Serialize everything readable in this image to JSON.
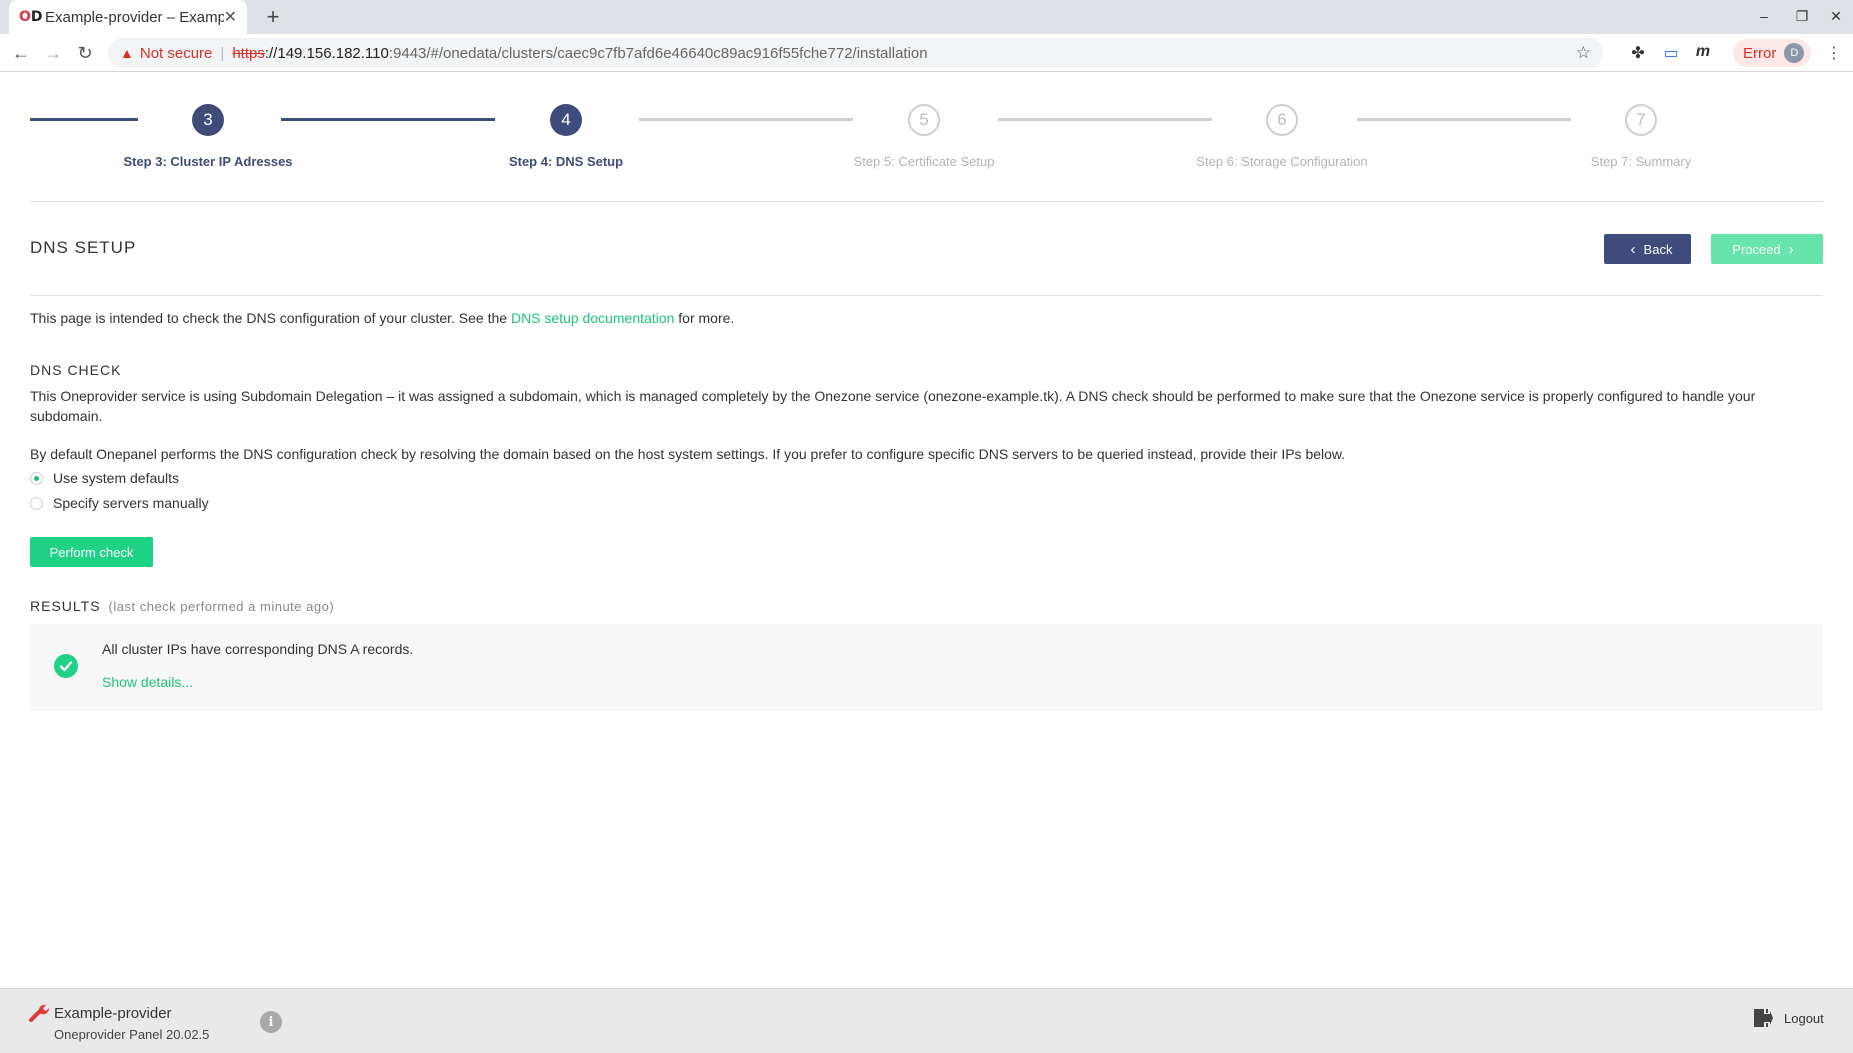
{
  "browser": {
    "tab_title": "Example-provider – Example",
    "favicon_text_a": "O",
    "favicon_text_b": "D",
    "new_tab": "+",
    "not_secure": "Not secure",
    "url_scheme": "https",
    "url_host": "://149.156.182.110",
    "url_rest": ":9443/#/onedata/clusters/caec9c7fb7afd6e46640c89ac916f55fche772/installation",
    "error_label": "Error",
    "profile_initial": "D"
  },
  "stepper": {
    "steps": [
      {
        "number": "3",
        "label": "Step 3: Cluster IP Adresses",
        "state": "done"
      },
      {
        "number": "4",
        "label": "Step 4: DNS Setup",
        "state": "done"
      },
      {
        "number": "5",
        "label": "Step 5: Certificate Setup",
        "state": "todo"
      },
      {
        "number": "6",
        "label": "Step 6: Storage Configuration",
        "state": "todo"
      },
      {
        "number": "7",
        "label": "Step 7: Summary",
        "state": "todo"
      }
    ]
  },
  "page": {
    "title": "DNS SETUP",
    "back_label": "Back",
    "proceed_label": "Proceed",
    "intro_before": "This page is intended to check the DNS configuration of your cluster. See the ",
    "intro_link": "DNS setup documentation",
    "intro_after": " for more.",
    "dns_check_title": "DNS CHECK",
    "dns_check_para": "This Oneprovider service is using Subdomain Delegation – it was assigned a subdomain, which is managed completely by the Onezone service (onezone-example.tk). A DNS check should be performed to make sure that the Onezone service is properly configured to handle your subdomain.",
    "default_para": "By default Onepanel performs the DNS configuration check by resolving the domain based on the host system settings. If you prefer to configure specific DNS servers to be queried instead, provide their IPs below.",
    "radio_system": "Use system defaults",
    "radio_manual": "Specify servers manually",
    "perform_check": "Perform check",
    "results_title": "RESULTS",
    "results_sub": "(last check performed a minute ago)",
    "result_text": "All cluster IPs have corresponding DNS A records.",
    "show_details": "Show details..."
  },
  "footer": {
    "provider_name": "Example-provider",
    "panel_version": "Oneprovider Panel 20.02.5",
    "info": "i",
    "logout": "Logout"
  },
  "colors": {
    "primary": "#3f4c7b",
    "accent_green": "#1fd286",
    "link_green": "#1fc37a"
  }
}
